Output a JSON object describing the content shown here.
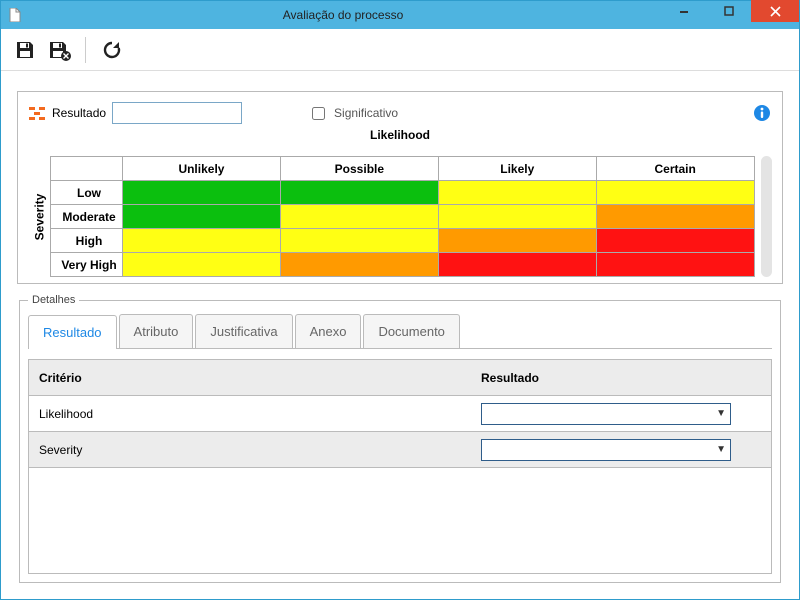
{
  "window": {
    "title": "Avaliação do processo"
  },
  "toolbar": {
    "save": "Save",
    "save_close": "Save and close",
    "refresh": "Refresh"
  },
  "top": {
    "resultado_label": "Resultado",
    "resultado_value": "",
    "significativo_label": "Significativo",
    "info": "Info"
  },
  "matrix": {
    "likelihood_title": "Likelihood",
    "severity_title": "Severity",
    "columns": [
      "Unlikely",
      "Possible",
      "Likely",
      "Certain"
    ],
    "rows": [
      "Low",
      "Moderate",
      "High",
      "Very High"
    ],
    "colors": [
      [
        "green",
        "green",
        "yellow",
        "yellow"
      ],
      [
        "green",
        "yellow",
        "yellow",
        "orange"
      ],
      [
        "yellow",
        "yellow",
        "orange",
        "red"
      ],
      [
        "yellow",
        "orange",
        "red",
        "red"
      ]
    ]
  },
  "details": {
    "legend": "Detalhes",
    "tabs": [
      "Resultado",
      "Atributo",
      "Justificativa",
      "Anexo",
      "Documento"
    ],
    "active_tab": 0,
    "grid": {
      "header_criterio": "Critério",
      "header_resultado": "Resultado",
      "rows": [
        {
          "criterio": "Likelihood",
          "value": ""
        },
        {
          "criterio": "Severity",
          "value": ""
        }
      ]
    }
  },
  "colors": {
    "accent": "#1e88e5",
    "titlebar": "#4eb4e0",
    "close": "#e2492f"
  }
}
